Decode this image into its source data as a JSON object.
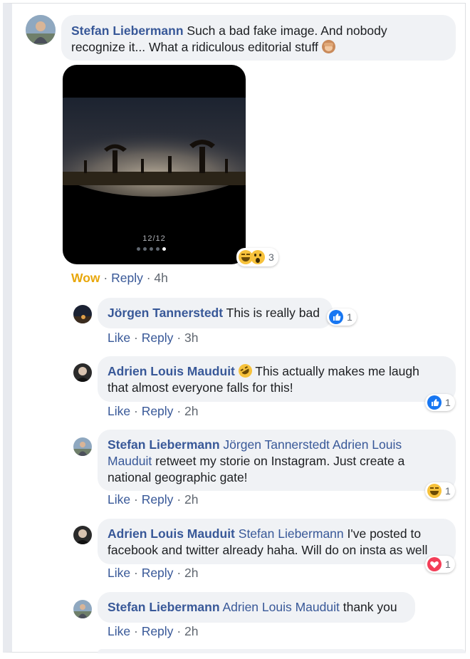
{
  "comments": [
    {
      "author": "Stefan Liebermann",
      "text_line1": "Such a bad fake image. And nobody",
      "text_line2": "recognize it... What a ridiculous editorial stuff",
      "image": {
        "counter": "12/12"
      },
      "reaction": {
        "count": "3",
        "icons": [
          "haha-emoji-icon",
          "wow-emoji-icon"
        ]
      },
      "actions": {
        "user_reaction": "Wow",
        "reply": "Reply",
        "time": "4h"
      },
      "colors": {
        "wow_label": "#e8a70b"
      }
    }
  ],
  "replies": [
    {
      "author": "Jörgen Tannerstedt",
      "text": "This is really bad",
      "reaction": {
        "count": "1",
        "icon": "like-reaction-icon"
      },
      "actions": {
        "like": "Like",
        "reply": "Reply",
        "time": "3h"
      }
    },
    {
      "author": "Adrien Louis Mauduit",
      "text_line1": "This actually makes me laugh",
      "text_line2": "that almost everyone falls for this!",
      "inline_emoji": "rofl-emoji-icon",
      "reaction": {
        "count": "1",
        "icon": "like-reaction-icon"
      },
      "actions": {
        "like": "Like",
        "reply": "Reply",
        "time": "2h"
      }
    },
    {
      "author": "Stefan Liebermann",
      "mention1": "Jörgen Tannerstedt",
      "mention2_part1": "Adrien Louis",
      "mention2_part2": "Mauduit",
      "text_line2": "retweet my storie on Instagram. Just create a",
      "text_line3": "national geographic gate!",
      "reaction": {
        "count": "1",
        "icon": "haha-reaction-icon"
      },
      "actions": {
        "like": "Like",
        "reply": "Reply",
        "time": "2h"
      }
    },
    {
      "author": "Adrien Louis Mauduit",
      "mention": "Stefan Liebermann",
      "text_line1": "I've posted to",
      "text_line2": "facebook and twitter already haha. Will do on insta as well",
      "reaction": {
        "count": "1",
        "icon": "love-reaction-icon"
      },
      "actions": {
        "like": "Like",
        "reply": "Reply",
        "time": "2h"
      }
    },
    {
      "author": "Stefan Liebermann",
      "mention": "Adrien Louis Mauduit",
      "text": "thank you",
      "actions": {
        "like": "Like",
        "reply": "Reply",
        "time": "2h"
      }
    }
  ],
  "separator": "·"
}
